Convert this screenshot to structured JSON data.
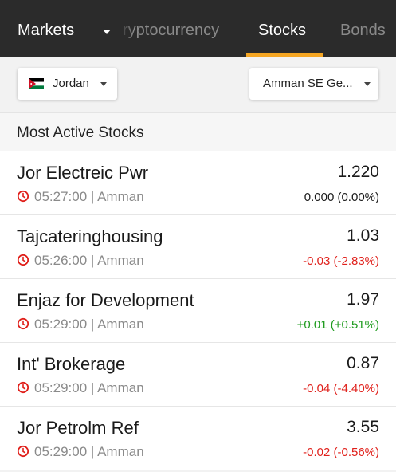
{
  "topbar": {
    "title": "Markets",
    "tabs": [
      {
        "label": "ryptocurrency",
        "active": false
      },
      {
        "label": "Stocks",
        "active": true
      },
      {
        "label": "Bonds",
        "active": false
      }
    ],
    "accent_color": "#f5a623"
  },
  "filters": {
    "country": {
      "label": "Jordan",
      "flag_icon": "jordan-flag-icon"
    },
    "exchange": {
      "label": "Amman SE Ge..."
    }
  },
  "section": {
    "title": "Most Active Stocks"
  },
  "colors": {
    "up": "#1e9b1e",
    "down": "#e0201b",
    "neutral": "#1a1a1a",
    "clock": "#e0201b"
  },
  "stocks": [
    {
      "name": "Jor Electreic Pwr",
      "price": "1.220",
      "time": "05:27:00 | Amman",
      "change": "0.000 (0.00%)",
      "direction": "neutral"
    },
    {
      "name": "Tajcateringhousing",
      "price": "1.03",
      "time": "05:26:00 | Amman",
      "change": "-0.03 (-2.83%)",
      "direction": "down"
    },
    {
      "name": "Enjaz for Development",
      "price": "1.97",
      "time": "05:29:00 | Amman",
      "change": "+0.01 (+0.51%)",
      "direction": "up"
    },
    {
      "name": "Int' Brokerage",
      "price": "0.87",
      "time": "05:29:00 | Amman",
      "change": "-0.04 (-4.40%)",
      "direction": "down"
    },
    {
      "name": "Jor Petrolm Ref",
      "price": "3.55",
      "time": "05:29:00 | Amman",
      "change": "-0.02 (-0.56%)",
      "direction": "down"
    }
  ]
}
